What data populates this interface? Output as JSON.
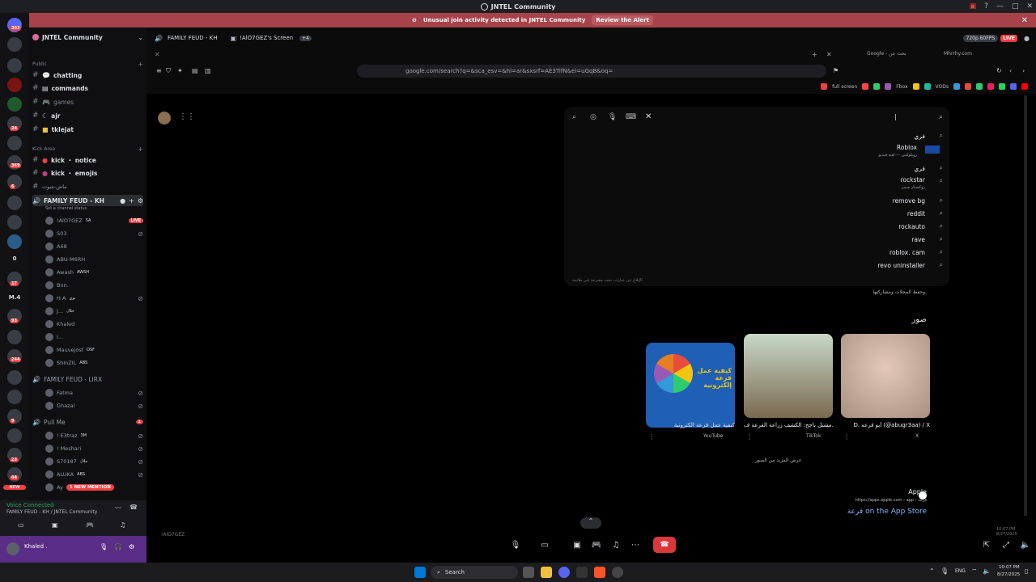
{
  "window": {
    "title": "JNTEL Community"
  },
  "alert": {
    "text": "Unusual join activity detected in JNTEL Community",
    "action": "Review the Alert"
  },
  "rail": {
    "badges": [
      "303",
      "24",
      "369",
      "6",
      "17",
      "93",
      "244",
      "9",
      "23",
      "26",
      "44"
    ],
    "labels": [
      "0",
      "M.4",
      "NEW"
    ]
  },
  "sidebar": {
    "server_name": "JNTEL Community",
    "categories": {
      "public": "Public",
      "kick": "Kick Area"
    },
    "channels": [
      {
        "label": "chatting"
      },
      {
        "label": "commands"
      },
      {
        "label": "games"
      },
      {
        "label": "ajr"
      },
      {
        "label": "tklejat"
      }
    ],
    "kick_channels": [
      {
        "label": "kick ・ notice"
      },
      {
        "label": "kick ・ emojis"
      },
      {
        "label": "ماش-شوت"
      }
    ],
    "voice1": {
      "name": "FAMILY FEUD - KH",
      "status": "Set a channel status"
    },
    "voice1_users": [
      "!AlO7GEZ",
      "S03",
      "A68",
      "ABU-M6RH",
      "Awash",
      "Bnn.",
      "H A",
      "J...",
      "Khaled",
      "I...",
      "Mauvejosf",
      "ShInZIL"
    ],
    "voice1_tags": {
      "u0": "SA",
      "u4": "AWSH",
      "u6": "نوي",
      "u7": "جلال",
      "u10": "OSF",
      "u11": "ABS"
    },
    "live": "LIVE",
    "voice2": {
      "name": "FAMILY FEUD - LIRX"
    },
    "voice2_users": [
      "Fatma",
      "Ghazal"
    ],
    "voice3": {
      "name": "Pull Me",
      "count": "1"
    },
    "voice3_users": [
      "! E3traz",
      "! Meshari",
      "S70187",
      "ALUKA",
      "Ay"
    ],
    "voice3_tags": {
      "u0": "3M",
      "u2": "جلال",
      "u3": "ABS"
    },
    "mention": "1 NEW MENTION"
  },
  "voice_panel": {
    "status": "Voice Connected",
    "channel": "FAMILY FEUD - KH / JNTEL Community"
  },
  "user_panel": {
    "name": "Khaled ."
  },
  "stream_header": {
    "channel": "FAMILY FEUD - KH",
    "screen": "!AlO7GEZ's Screen",
    "quality": "720p 60FPS",
    "live": "LIVE",
    "count": "+4"
  },
  "browser": {
    "url": "google.com/search?q=&sca_esv=&hl=ar&sxsrf=AE3TifN&ei=uGqB&oq=",
    "tabs_right": [
      "Google - بحث عن",
      "Mhrrhy.com",
      "Google - بحث"
    ],
    "bookmarks": [
      "full screen",
      "Fbox",
      "VODs"
    ]
  },
  "google": {
    "suggestions": [
      {
        "text": "فري"
      },
      {
        "text": "Roblox",
        "sub": "روبلوكس — لعبة فيديو"
      },
      {
        "text": "قري"
      },
      {
        "text": "rockstar",
        "sub": "روكستار جيمز"
      },
      {
        "text": "remove bg"
      },
      {
        "text": "reddit"
      },
      {
        "text": "rockauto"
      },
      {
        "text": "rave"
      },
      {
        "text": "roblox. cam"
      },
      {
        "text": "revo uninstaller"
      }
    ],
    "report": "الإبلاغ عن عبارات بحث مقترحة غير ملائمة",
    "snippet": "وحفظ المجلات ومشاركتها.",
    "images_heading": "صور",
    "images": [
      {
        "caption": "كيفية عمل قرعة الكترونية",
        "source": "YouTube",
        "thumb_text": "كيفية عمل قرعة إلكترونية"
      },
      {
        "caption": "مشتل ناجح: الكشف زراعة القرعة ف...",
        "source": "TikTok"
      },
      {
        "caption": "D. أبو قرعه (@abugr3aa) / X",
        "source": "X"
      }
    ],
    "more_images": "عرض المزيد من الصور",
    "result": {
      "site": "Apple",
      "breadcrumb": "https://apps.apple.com › app › قرعة",
      "title": "قرعة on the App Store"
    }
  },
  "callbar": {
    "caller": "!AlO7GEZ"
  },
  "taskbar": {
    "search": "Search",
    "lang": "ENG",
    "time": "10:07 PM",
    "date": "8/27/2025",
    "time2": "10:07 PM",
    "date2": "8/27/2025"
  },
  "colors": {
    "live": "#f23f43",
    "alert": "#a8424a",
    "user_panel": "#5a2d86",
    "voice_connected": "#23a55a"
  }
}
